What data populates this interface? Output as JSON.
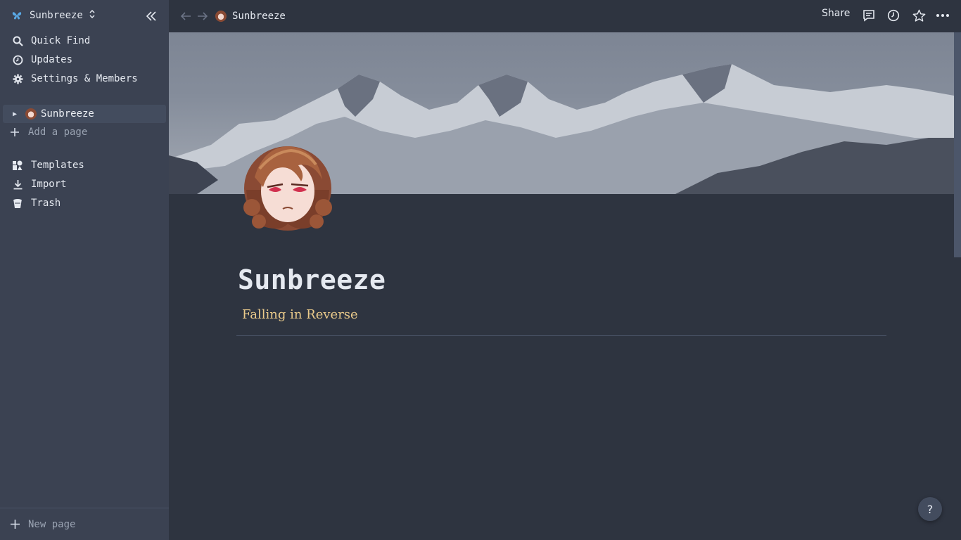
{
  "workspace": {
    "name": "Sunbreeze"
  },
  "sidebar": {
    "nav": [
      {
        "label": "Quick Find",
        "icon": "search-icon"
      },
      {
        "label": "Updates",
        "icon": "clock-icon"
      },
      {
        "label": "Settings & Members",
        "icon": "gear-icon"
      }
    ],
    "pages": [
      {
        "label": "Sunbreeze"
      }
    ],
    "add_page": "Add a page",
    "tools": [
      {
        "label": "Templates",
        "icon": "templates-icon"
      },
      {
        "label": "Import",
        "icon": "download-icon"
      },
      {
        "label": "Trash",
        "icon": "trash-icon"
      }
    ],
    "new_page": "New page"
  },
  "topbar": {
    "breadcrumb": "Sunbreeze",
    "share": "Share"
  },
  "page": {
    "title": "Sunbreeze",
    "subtitle": "Falling in Reverse"
  },
  "help": {
    "label": "?"
  },
  "colors": {
    "background": "#2e3440",
    "sidebar": "#3b4252",
    "accent_subtitle": "#ebcb8b",
    "workspace_icon": "#5aa9e6"
  }
}
